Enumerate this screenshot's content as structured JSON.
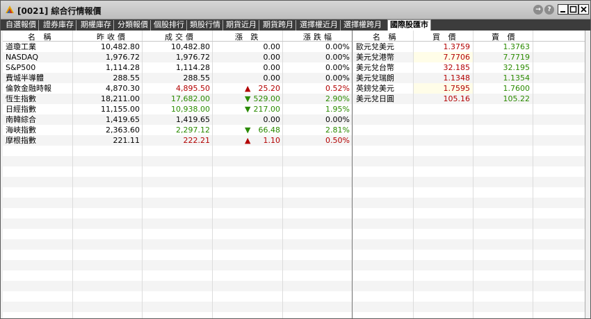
{
  "window": {
    "title": "[0021] 綜合行情報價",
    "buttons": [
      "→",
      "?"
    ]
  },
  "tabs": [
    {
      "label": "自選報價",
      "active": false
    },
    {
      "label": "證券庫存",
      "active": false
    },
    {
      "label": "期權庫存",
      "active": false
    },
    {
      "label": "分類報價",
      "active": false
    },
    {
      "label": "個股排行",
      "active": false
    },
    {
      "label": "類股行情",
      "active": false
    },
    {
      "label": "期貨近月",
      "active": false
    },
    {
      "label": "期貨跨月",
      "active": false
    },
    {
      "label": "選擇權近月",
      "active": false
    },
    {
      "label": "選擇權跨月",
      "active": false
    },
    {
      "label": "國際股匯市",
      "active": true
    }
  ],
  "indices": {
    "headers": [
      "名 稱",
      "昨收價",
      "成交價",
      "漲 跌",
      "漲跌幅"
    ],
    "rows": [
      {
        "name": "道瓊工業",
        "prev": "10,482.80",
        "last": "10,482.80",
        "change": "0.00",
        "pct": "0.00%",
        "dir": "flat"
      },
      {
        "name": "NASDAQ",
        "prev": "1,976.72",
        "last": "1,976.72",
        "change": "0.00",
        "pct": "0.00%",
        "dir": "flat"
      },
      {
        "name": "S&P500",
        "prev": "1,114.28",
        "last": "1,114.28",
        "change": "0.00",
        "pct": "0.00%",
        "dir": "flat"
      },
      {
        "name": "費城半導體",
        "prev": "288.55",
        "last": "288.55",
        "change": "0.00",
        "pct": "0.00%",
        "dir": "flat"
      },
      {
        "name": "倫敦金融時報",
        "prev": "4,870.30",
        "last": "4,895.50",
        "change": "25.20",
        "pct": "0.52%",
        "dir": "up"
      },
      {
        "name": "恆生指數",
        "prev": "18,211.00",
        "last": "17,682.00",
        "change": "529.00",
        "pct": "2.90%",
        "dir": "down"
      },
      {
        "name": "日經指數",
        "prev": "11,155.00",
        "last": "10,938.00",
        "change": "217.00",
        "pct": "1.95%",
        "dir": "down"
      },
      {
        "name": "南韓綜合",
        "prev": "1,419.65",
        "last": "1,419.65",
        "change": "0.00",
        "pct": "0.00%",
        "dir": "flat"
      },
      {
        "name": "海峽指數",
        "prev": "2,363.60",
        "last": "2,297.12",
        "change": "66.48",
        "pct": "2.81%",
        "dir": "down"
      },
      {
        "name": "摩根指數",
        "prev": "221.11",
        "last": "222.21",
        "change": "1.10",
        "pct": "0.50%",
        "dir": "up"
      }
    ]
  },
  "fx": {
    "headers": [
      "名 稱",
      "買 價",
      "賣 價"
    ],
    "rows": [
      {
        "name": "歐元兌美元",
        "bid": "1.3759",
        "ask": "1.3763"
      },
      {
        "name": "美元兌港幣",
        "bid": "7.7706",
        "ask": "7.7719"
      },
      {
        "name": "美元兌台幣",
        "bid": "32.185",
        "ask": "32.195"
      },
      {
        "name": "美元兌瑞朗",
        "bid": "1.1348",
        "ask": "1.1354"
      },
      {
        "name": "英鎊兌美元",
        "bid": "1.7595",
        "ask": "1.7600"
      },
      {
        "name": "美元兌日圓",
        "bid": "105.16",
        "ask": "105.22"
      }
    ]
  },
  "colors": {
    "up": "#b30000",
    "down": "#2a8a00",
    "tab_bar": "#3c3c3c"
  }
}
